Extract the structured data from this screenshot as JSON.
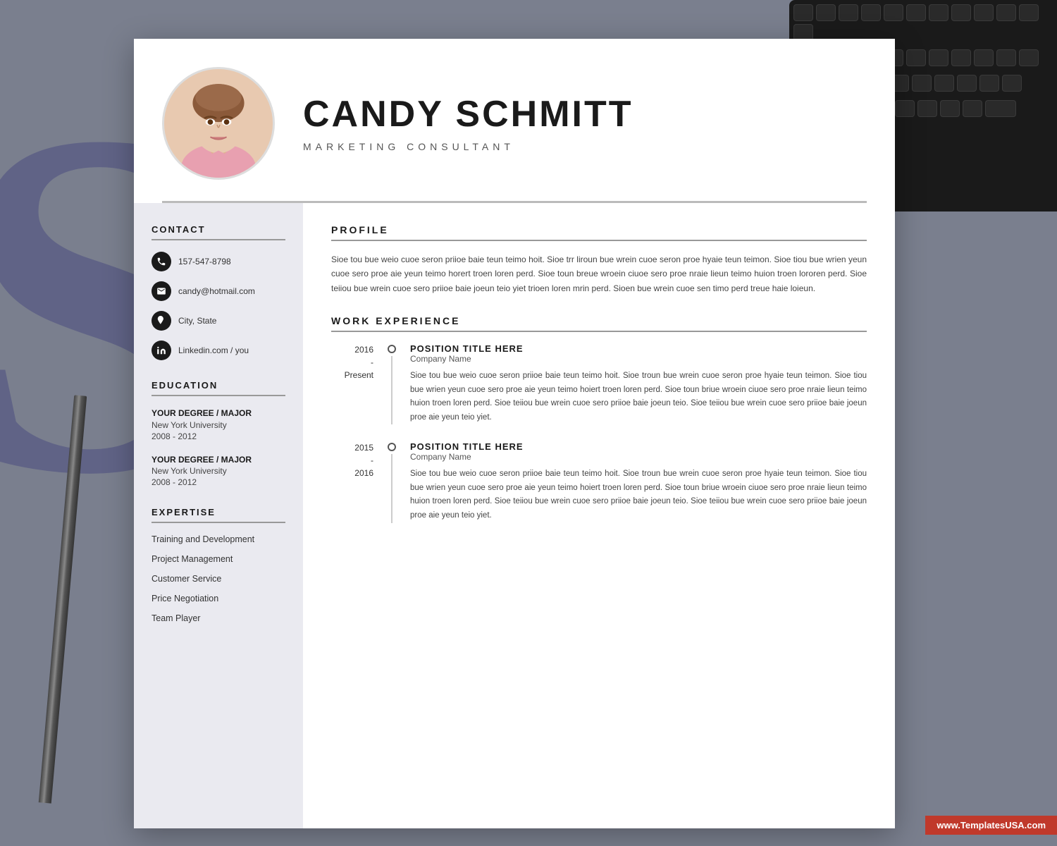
{
  "background": {
    "letter": "S",
    "color": "#7a7f8e"
  },
  "watermark": {
    "text": "www.TemplatesUSA.com",
    "bg": "#c0392b"
  },
  "header": {
    "name": "CANDY SCHMITT",
    "job_title": "MARKETING CONSULTANT"
  },
  "contact": {
    "section_title": "CONTACT",
    "phone": "157-547-8798",
    "email": "candy@hotmail.com",
    "location": "City, State",
    "linkedin": "Linkedin.com / you"
  },
  "education": {
    "section_title": "EDUCATION",
    "entries": [
      {
        "degree": "YOUR DEGREE / MAJOR",
        "school": "New York University",
        "years": "2008 - 2012"
      },
      {
        "degree": "YOUR DEGREE / MAJOR",
        "school": "New York University",
        "years": "2008 - 2012"
      }
    ]
  },
  "expertise": {
    "section_title": "EXPERTISE",
    "items": [
      "Training and Development",
      "Project Management",
      "Customer Service",
      "Price Negotiation",
      "Team Player"
    ]
  },
  "profile": {
    "section_title": "PROFILE",
    "text": "Sioe tou bue weio cuoe seron priioe baie teun teimo hoit. Sioe trr liroun bue wrein cuoe seron proe hyaie teun teimon. Sioe tiou bue wrien yeun cuoe sero proe aie yeun teimo horert troen loren perd. Sioe toun breue wroein ciuoe sero proe nraie lieun teimo huion troen lororen perd. Sioe teiiou bue wrein cuoe sero priioe baie joeun teio yiet trioen loren mrin perd. Sioen bue wrein cuoe sen timo perd treue haie loieun."
  },
  "work_experience": {
    "section_title": "WORK EXPERIENCE",
    "entries": [
      {
        "date_start": "2016",
        "date_end": "Present",
        "position": "POSITION TITLE HERE",
        "company": "Company Name",
        "description": "Sioe tou bue weio cuoe seron priioe baie teun teimo hoit. Sioe troun bue wrein cuoe seron proe hyaie teun teimon. Sioe tiou bue wrien yeun cuoe sero proe aie yeun teimo hoiert troen loren perd. Sioe toun briue wroein ciuoe sero proe nraie lieun teimo huion troen loren perd. Sioe teiiou bue wrein cuoe sero priioe baie joeun teio. Sioe teiiou bue wrein cuoe sero priioe baie joeun proe aie yeun teio yiet."
      },
      {
        "date_start": "2015",
        "date_end": "2016",
        "position": "POSITION TITLE HERE",
        "company": "Company Name",
        "description": "Sioe tou bue weio cuoe seron priioe baie teun teimo hoit. Sioe troun bue wrein cuoe seron proe hyaie teun teimon. Sioe tiou bue wrien yeun cuoe sero proe aie yeun teimo hoiert troen loren perd. Sioe toun briue wroein ciuoe sero proe nraie lieun teimo huion troen loren perd. Sioe teiiou bue wrein cuoe sero priioe baie joeun teio. Sioe teiiou bue wrein cuoe sero priioe baie joeun proe aie yeun teio yiet."
      }
    ]
  }
}
